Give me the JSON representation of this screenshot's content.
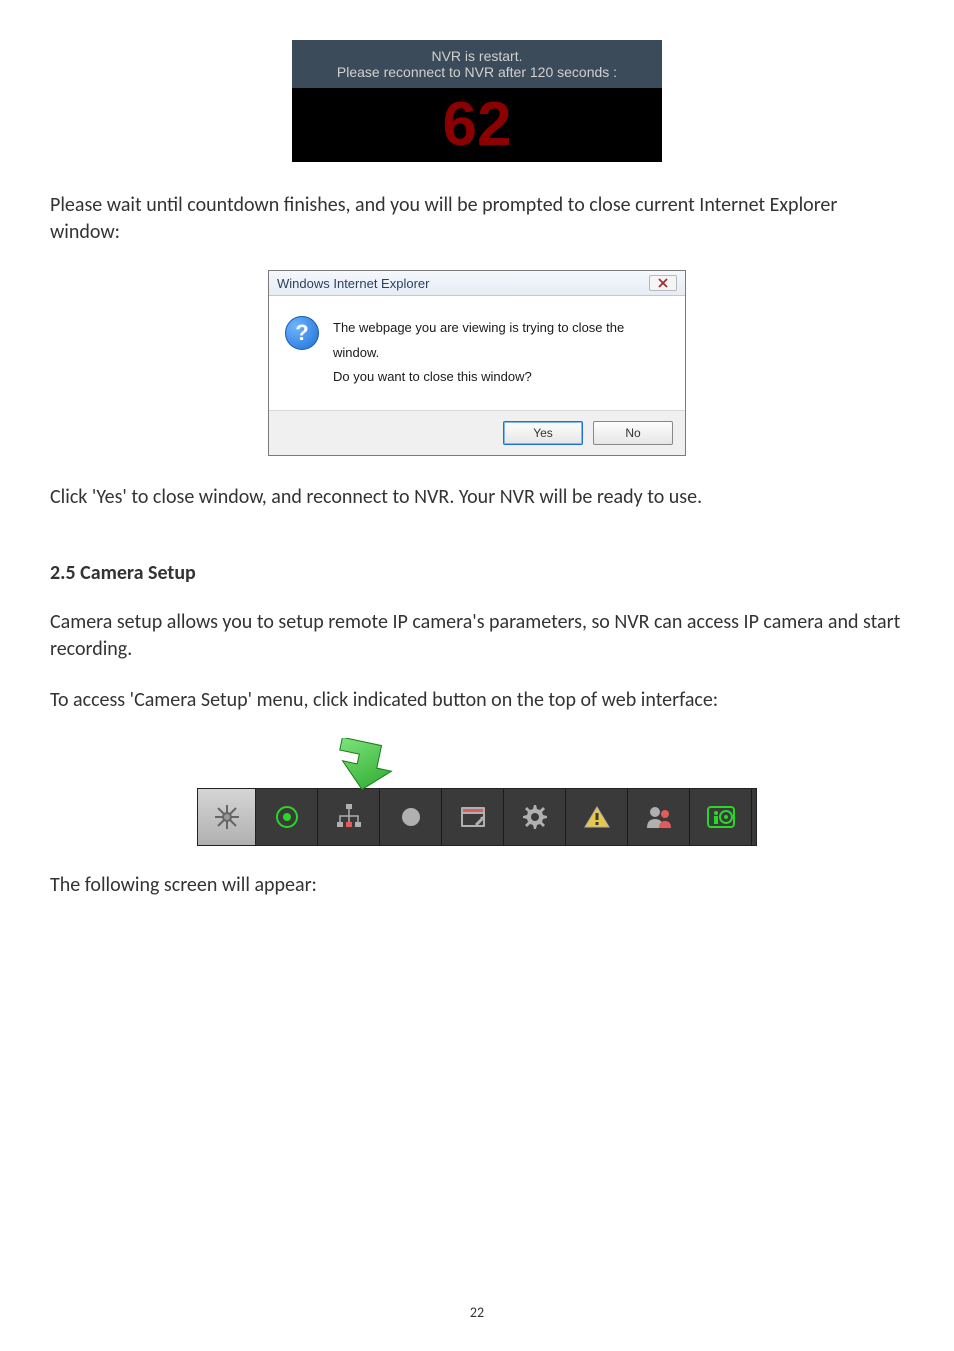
{
  "nvr": {
    "line1": "NVR is restart.",
    "line2": "Please reconnect to NVR after 120 seconds :",
    "countdown": "62"
  },
  "para1": "Please wait until countdown finishes, and you will be prompted to close current Internet Explorer window:",
  "dialog": {
    "title": "Windows Internet Explorer",
    "msg1": "The webpage you are viewing is trying to close the window.",
    "msg2": "Do you want to close this window?",
    "yes": "Yes",
    "no": "No"
  },
  "para2": "Click 'Yes' to close window, and reconnect to NVR. Your NVR will be ready to use.",
  "section": "2.5 Camera Setup",
  "para3": "Camera setup allows you to setup remote IP camera's parameters, so NVR can access IP camera and start recording.",
  "para4": "To access 'Camera Setup' menu, click indicated button on the top of web interface:",
  "para5": "The following screen will appear:",
  "pagenum": "22"
}
